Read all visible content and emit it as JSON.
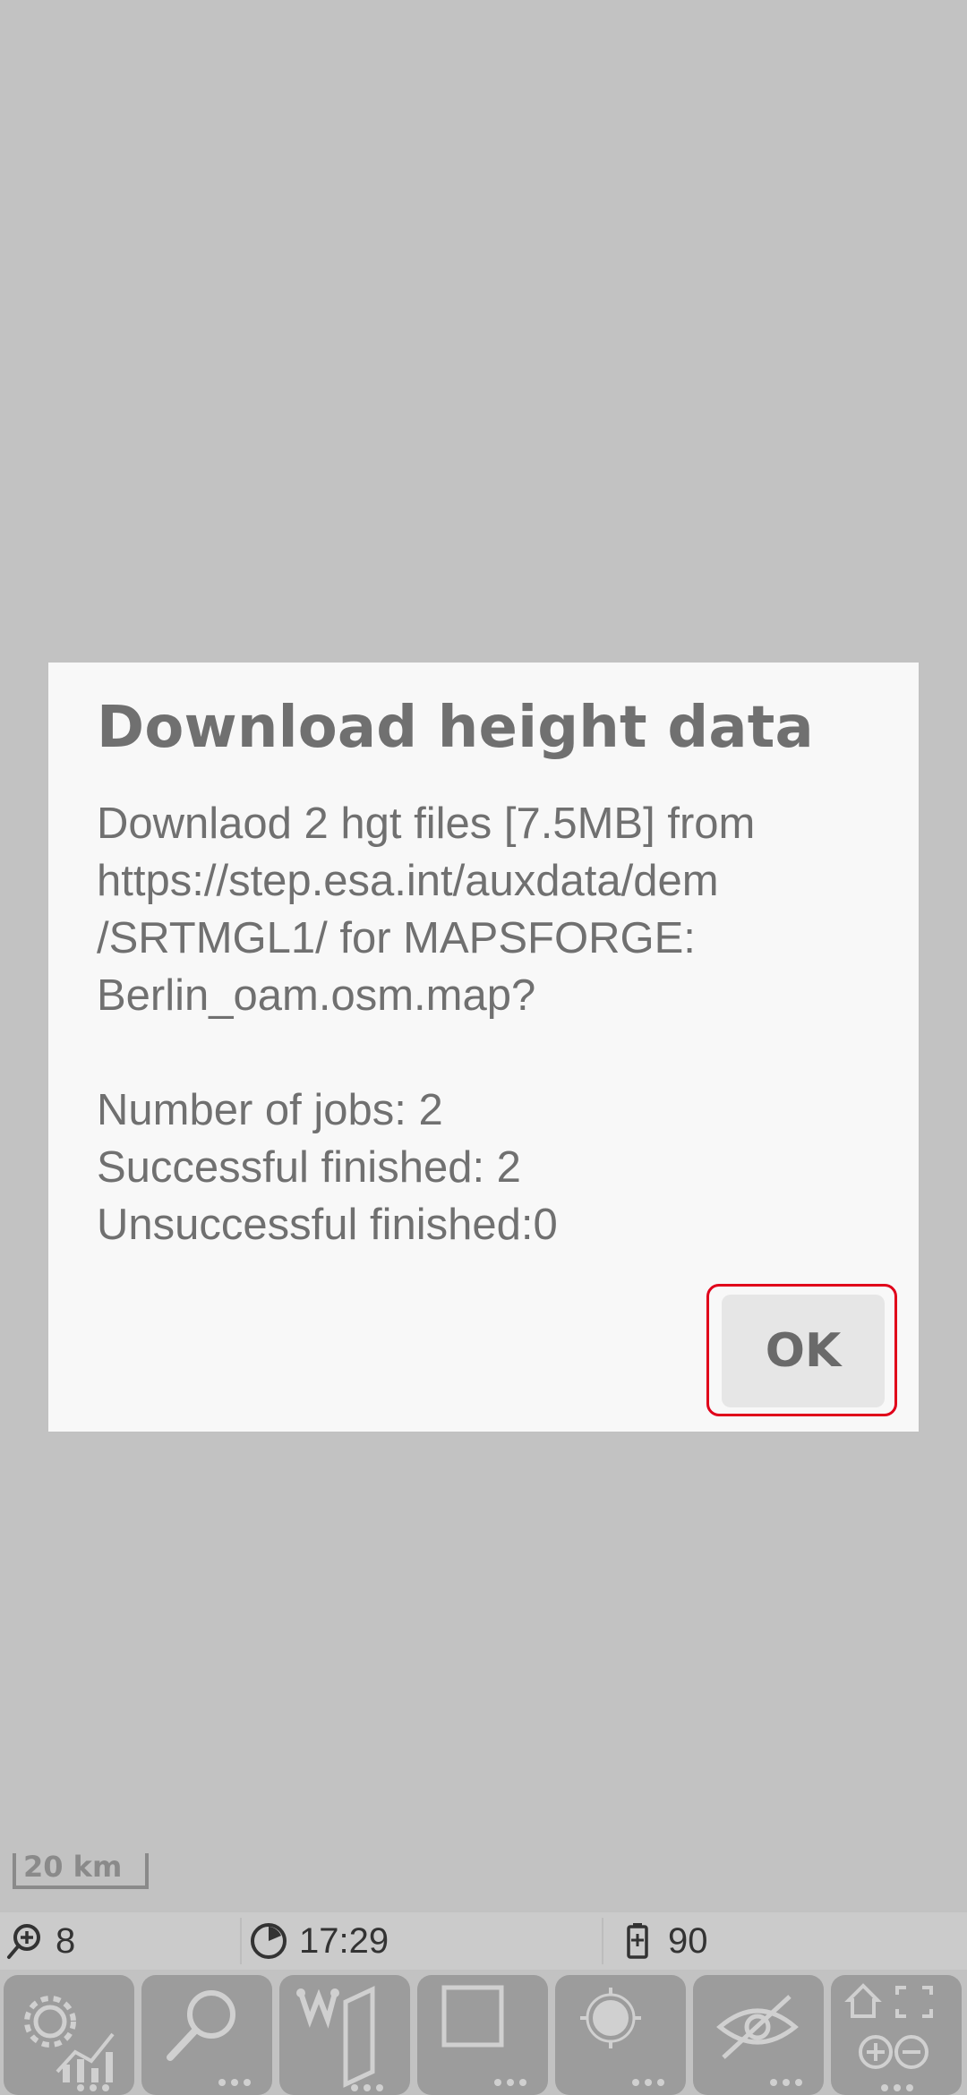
{
  "dialog": {
    "title": "Download height data",
    "message_lines": [
      "Downlaod 2 hgt files [7.5MB] from",
      "https://step.esa.int/auxdata/dem",
      "/SRTMGL1/ for MAPSFORGE:",
      "Berlin_oam.osm.map?"
    ],
    "stats_lines": [
      "Number of jobs: 2",
      "Successful finished: 2",
      "Unsuccessful finished:0"
    ],
    "ok_label": "OK"
  },
  "scale_bar": {
    "label": "20 km"
  },
  "status_bar": {
    "zoom": "8",
    "time": "17:29",
    "battery": "90"
  },
  "toolbar": {
    "buttons": [
      {
        "icon": "settings-statistics-icon"
      },
      {
        "icon": "search-icon"
      },
      {
        "icon": "waypoint-route-icon"
      },
      {
        "icon": "square-draw-icon"
      },
      {
        "icon": "gps-location-icon"
      },
      {
        "icon": "hide-eye-icon"
      },
      {
        "icon": "home-zoom-fullscreen-icon"
      }
    ]
  },
  "colors": {
    "map_background": "#c2c2c2",
    "dialog_background": "#f8f8f8",
    "focus_ring": "#e0001a",
    "toolbar_button": "#9c9c9c"
  }
}
